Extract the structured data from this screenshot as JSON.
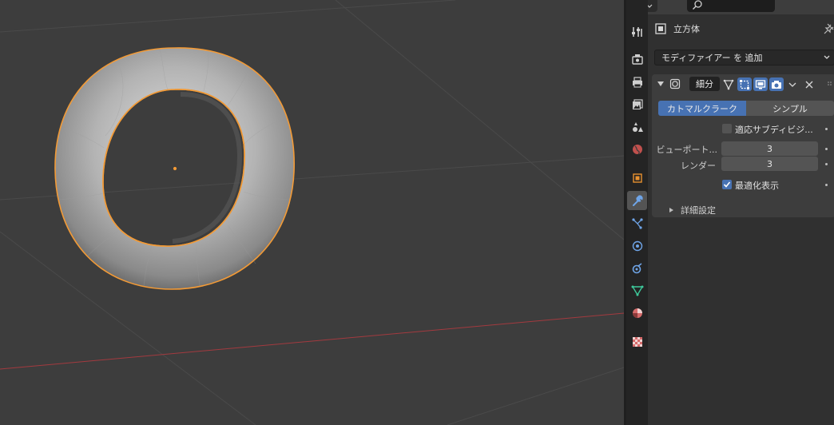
{
  "properties_panel": {
    "object_name": "立方体",
    "add_modifier_label": "モディファイアー を 追加",
    "modifier": {
      "name": "細分",
      "subdivision_type": {
        "options": [
          "カトマルクラーク",
          "シンプル"
        ],
        "selected": "カトマルクラーク"
      },
      "adaptive_subdivision": {
        "label": "適応サブディビジ...",
        "checked": false
      },
      "viewport_levels": {
        "label": "ビューポート...",
        "value": "3"
      },
      "render_levels": {
        "label": "レンダー",
        "value": "3"
      },
      "optimal_display": {
        "label": "最適化表示",
        "checked": true
      },
      "advanced_label": "詳細設定"
    }
  },
  "tabs": [
    "tool",
    "render",
    "output",
    "view-layer",
    "scene",
    "world",
    "object",
    "modifiers",
    "particles",
    "physics",
    "constraints",
    "data",
    "material",
    "texture"
  ],
  "active_tab": "modifiers",
  "colors": {
    "accent": "#4772b3",
    "selection_outline": "#f29a36",
    "x_axis": "#a33a3f"
  }
}
